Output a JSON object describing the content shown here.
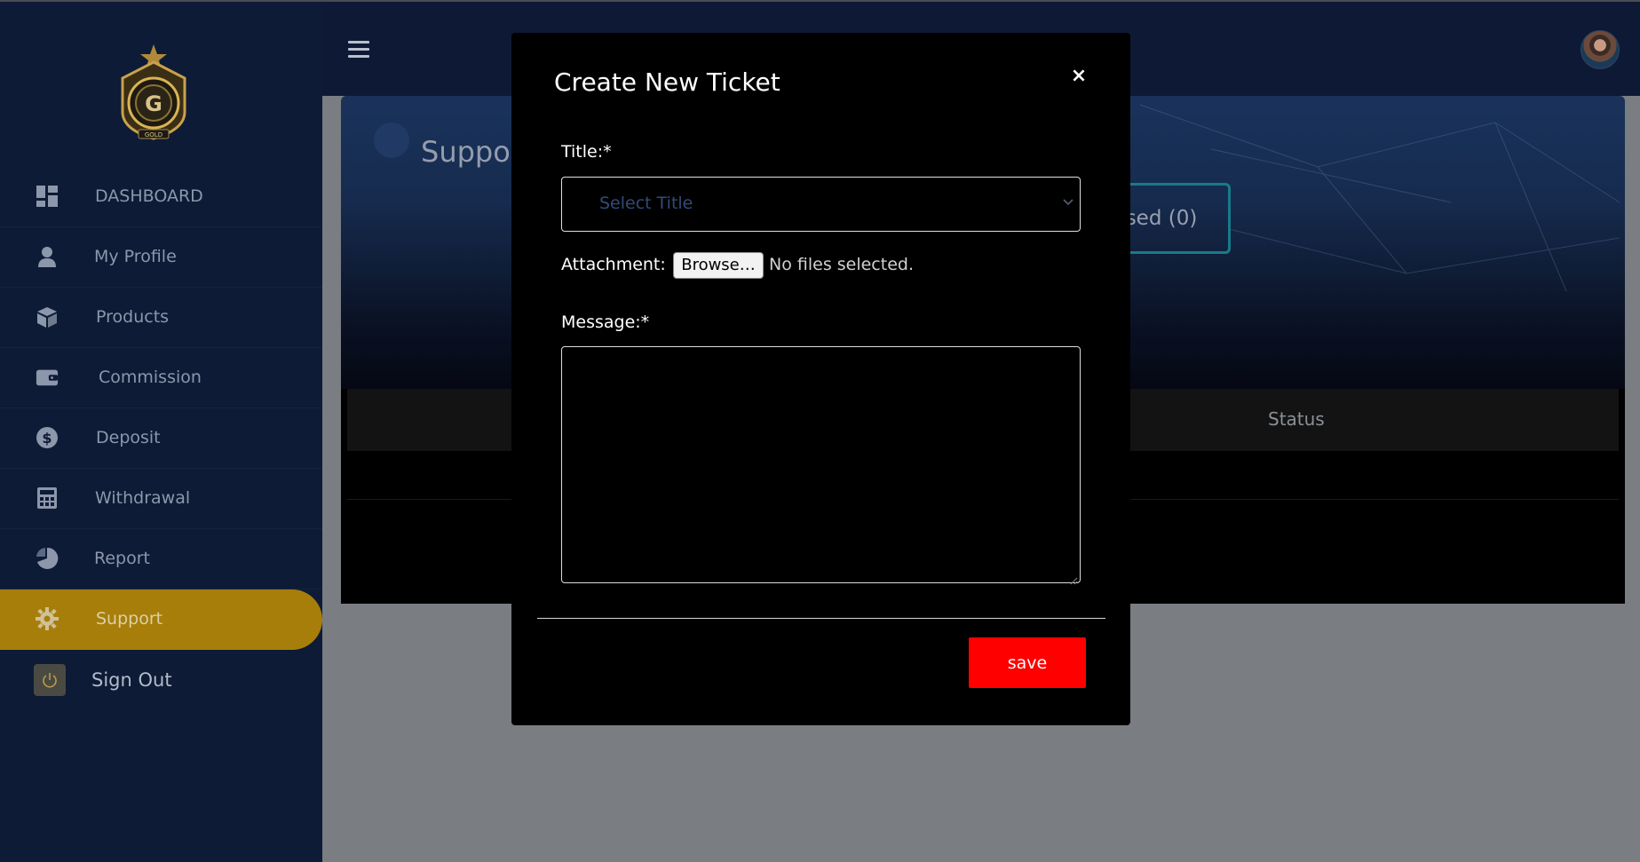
{
  "sidebar": {
    "items": [
      {
        "label": "DASHBOARD",
        "icon": "dashboard-icon"
      },
      {
        "label": "My Profile",
        "icon": "user-icon"
      },
      {
        "label": "Products",
        "icon": "box-icon"
      },
      {
        "label": "Commission",
        "icon": "wallet-icon"
      },
      {
        "label": "Deposit",
        "icon": "dollar-icon"
      },
      {
        "label": "Withdrawal",
        "icon": "calculator-icon"
      },
      {
        "label": "Report",
        "icon": "pie-chart-icon"
      },
      {
        "label": "Support",
        "icon": "gear-icon"
      },
      {
        "label": "Sign Out",
        "icon": "power-icon"
      }
    ],
    "active_item": "Support",
    "logo_text": "GOLD"
  },
  "header": {
    "menu_icon": "hamburger-icon",
    "avatar_icon": "avatar"
  },
  "page": {
    "heading_partial": "Suppo",
    "closed_tab_partial": "sed (0)",
    "table_status_header": "Status"
  },
  "modal": {
    "title": "Create New Ticket",
    "close_label": "×",
    "title_label": "Title:*",
    "title_placeholder": "Select Title",
    "attachment_label": "Attachment:",
    "browse_label": "Browse…",
    "no_files_text": "No files selected.",
    "message_label": "Message:*",
    "message_value": "",
    "save_label": "save"
  },
  "colors": {
    "sidebar_bg": "#0d1b36",
    "active_item_bg": "#a77e09",
    "save_button": "#ff0000",
    "modal_bg": "#000000",
    "accent_teal": "#1b8c9c"
  }
}
